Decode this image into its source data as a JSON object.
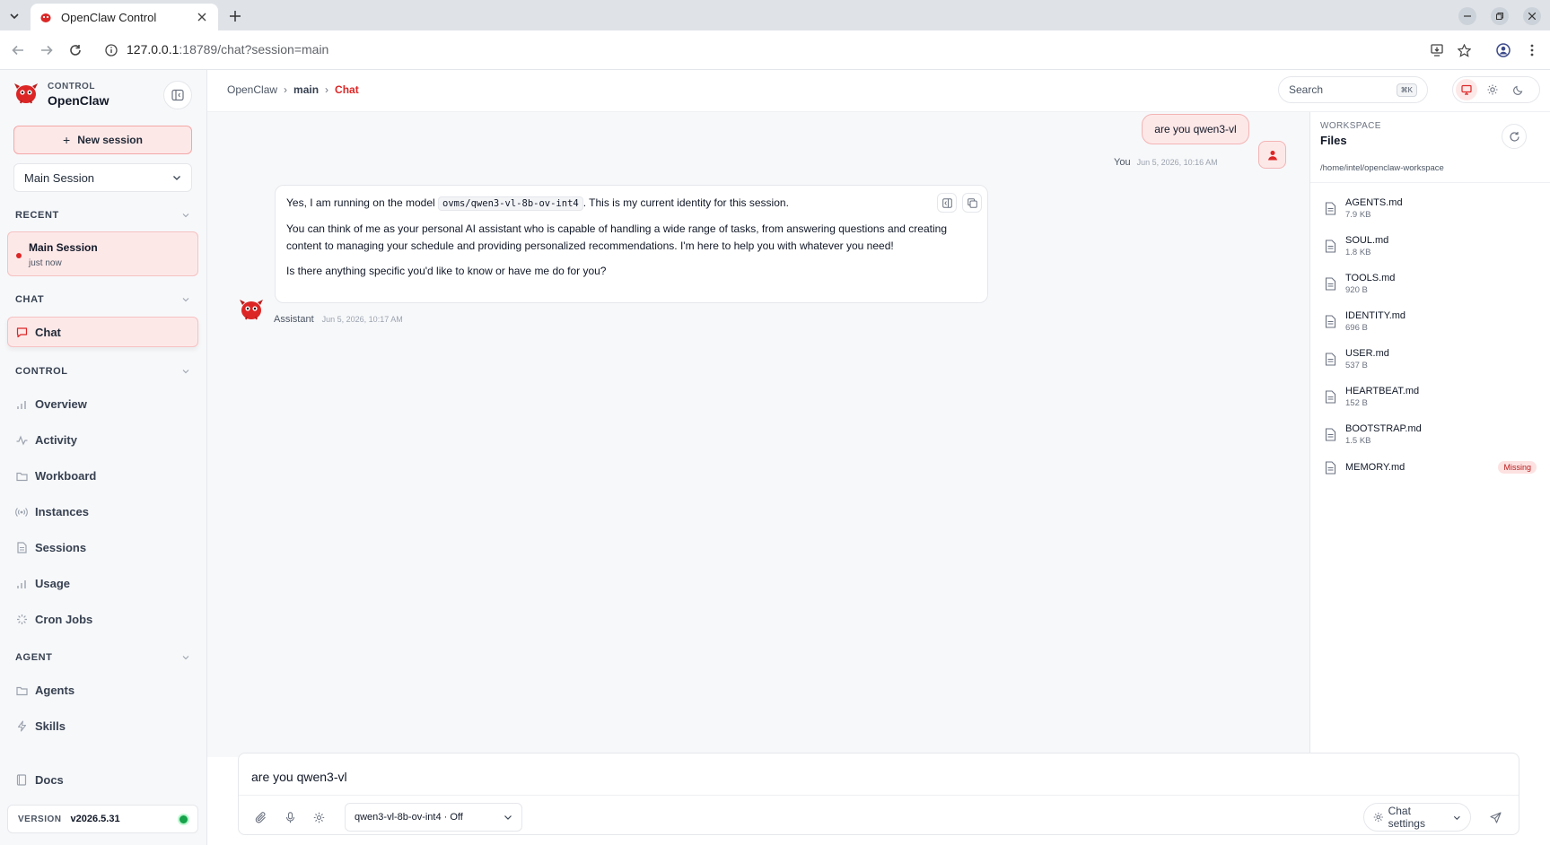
{
  "browser": {
    "tab_title": "OpenClaw Control",
    "url_host": "127.0.0.1",
    "url_path": ":18789/chat?session=main"
  },
  "sidebar": {
    "brand_kicker": "CONTROL",
    "brand_name": "OpenClaw",
    "new_session_label": "New session",
    "session_select": "Main Session",
    "sections": {
      "recent": "RECENT",
      "chat": "CHAT",
      "control": "CONTROL",
      "agent": "AGENT"
    },
    "recent_item": {
      "name": "Main Session",
      "time": "just now"
    },
    "chat_item": "Chat",
    "control_items": [
      "Overview",
      "Activity",
      "Workboard",
      "Instances",
      "Sessions",
      "Usage",
      "Cron Jobs"
    ],
    "agent_items": [
      "Agents",
      "Skills"
    ],
    "docs": "Docs",
    "version_label": "VERSION",
    "version_value": "v2026.5.31"
  },
  "header": {
    "breadcrumb": [
      "OpenClaw",
      "main",
      "Chat"
    ],
    "search_placeholder": "Search",
    "search_shortcut": "⌘K"
  },
  "chat": {
    "user_message": "are you qwen3-vl",
    "user_name": "You",
    "user_time": "Jun 5, 2026, 10:16 AM",
    "assistant_p1_before": "Yes, I am running on the model ",
    "assistant_p1_code": "ovms/qwen3-vl-8b-ov-int4",
    "assistant_p1_after": ". This is my current identity for this session.",
    "assistant_p2": "You can think of me as your personal AI assistant who is capable of handling a wide range of tasks, from answering questions and creating content to managing your schedule and providing personalized recommendations. I'm here to help you with whatever you need!",
    "assistant_p3": "Is there anything specific you'd like to know or have me do for you?",
    "assistant_name": "Assistant",
    "assistant_time": "Jun 5, 2026, 10:17 AM"
  },
  "workspace": {
    "kicker": "WORKSPACE",
    "title": "Files",
    "path": "/home/intel/openclaw-workspace",
    "files": [
      {
        "name": "AGENTS.md",
        "size": "7.9 KB"
      },
      {
        "name": "SOUL.md",
        "size": "1.8 KB"
      },
      {
        "name": "TOOLS.md",
        "size": "920 B"
      },
      {
        "name": "IDENTITY.md",
        "size": "696 B"
      },
      {
        "name": "USER.md",
        "size": "537 B"
      },
      {
        "name": "HEARTBEAT.md",
        "size": "152 B"
      },
      {
        "name": "BOOTSTRAP.md",
        "size": "1.5 KB"
      },
      {
        "name": "MEMORY.md",
        "size": "",
        "badge": "Missing"
      }
    ]
  },
  "composer": {
    "input_value": "are you qwen3-vl",
    "model_select": "qwen3-vl-8b-ov-int4 · Off",
    "chat_settings": "Chat settings"
  },
  "colors": {
    "accent": "#dc2626",
    "accent_soft": "#fde8e8",
    "status_ok": "#16a34a"
  }
}
